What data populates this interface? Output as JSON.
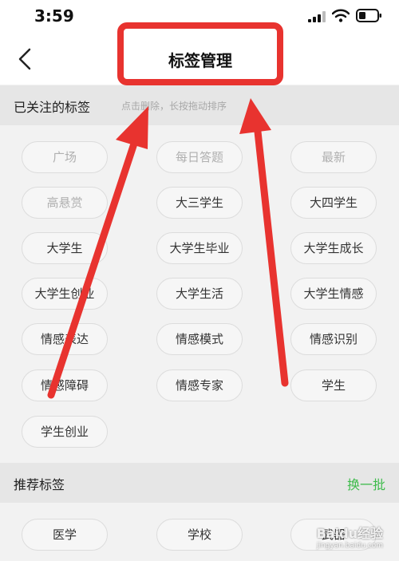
{
  "status_bar": {
    "time": "3:59"
  },
  "nav": {
    "title": "标签管理"
  },
  "followed": {
    "title": "已关注的标签",
    "hint": "点击删除，长按拖动排序",
    "tags": [
      "广场",
      "每日答题",
      "最新",
      "高悬赏",
      "大三学生",
      "大四学生",
      "大学生",
      "大学生毕业",
      "大学生成长",
      "大学生创业",
      "大学生活",
      "大学生情感",
      "情感表达",
      "情感模式",
      "情感识别",
      "情感障碍",
      "情感专家",
      "学生",
      "学生创业"
    ]
  },
  "recommended": {
    "title": "推荐标签",
    "swap_label": "换一批",
    "tags": [
      "医学",
      "学校",
      "武器"
    ]
  },
  "watermark": {
    "main": "Baidu经验",
    "sub": "jingyan.baidu.com"
  },
  "colors": {
    "accent_green": "#3dbb4b",
    "annotation_red": "#e8332f"
  }
}
